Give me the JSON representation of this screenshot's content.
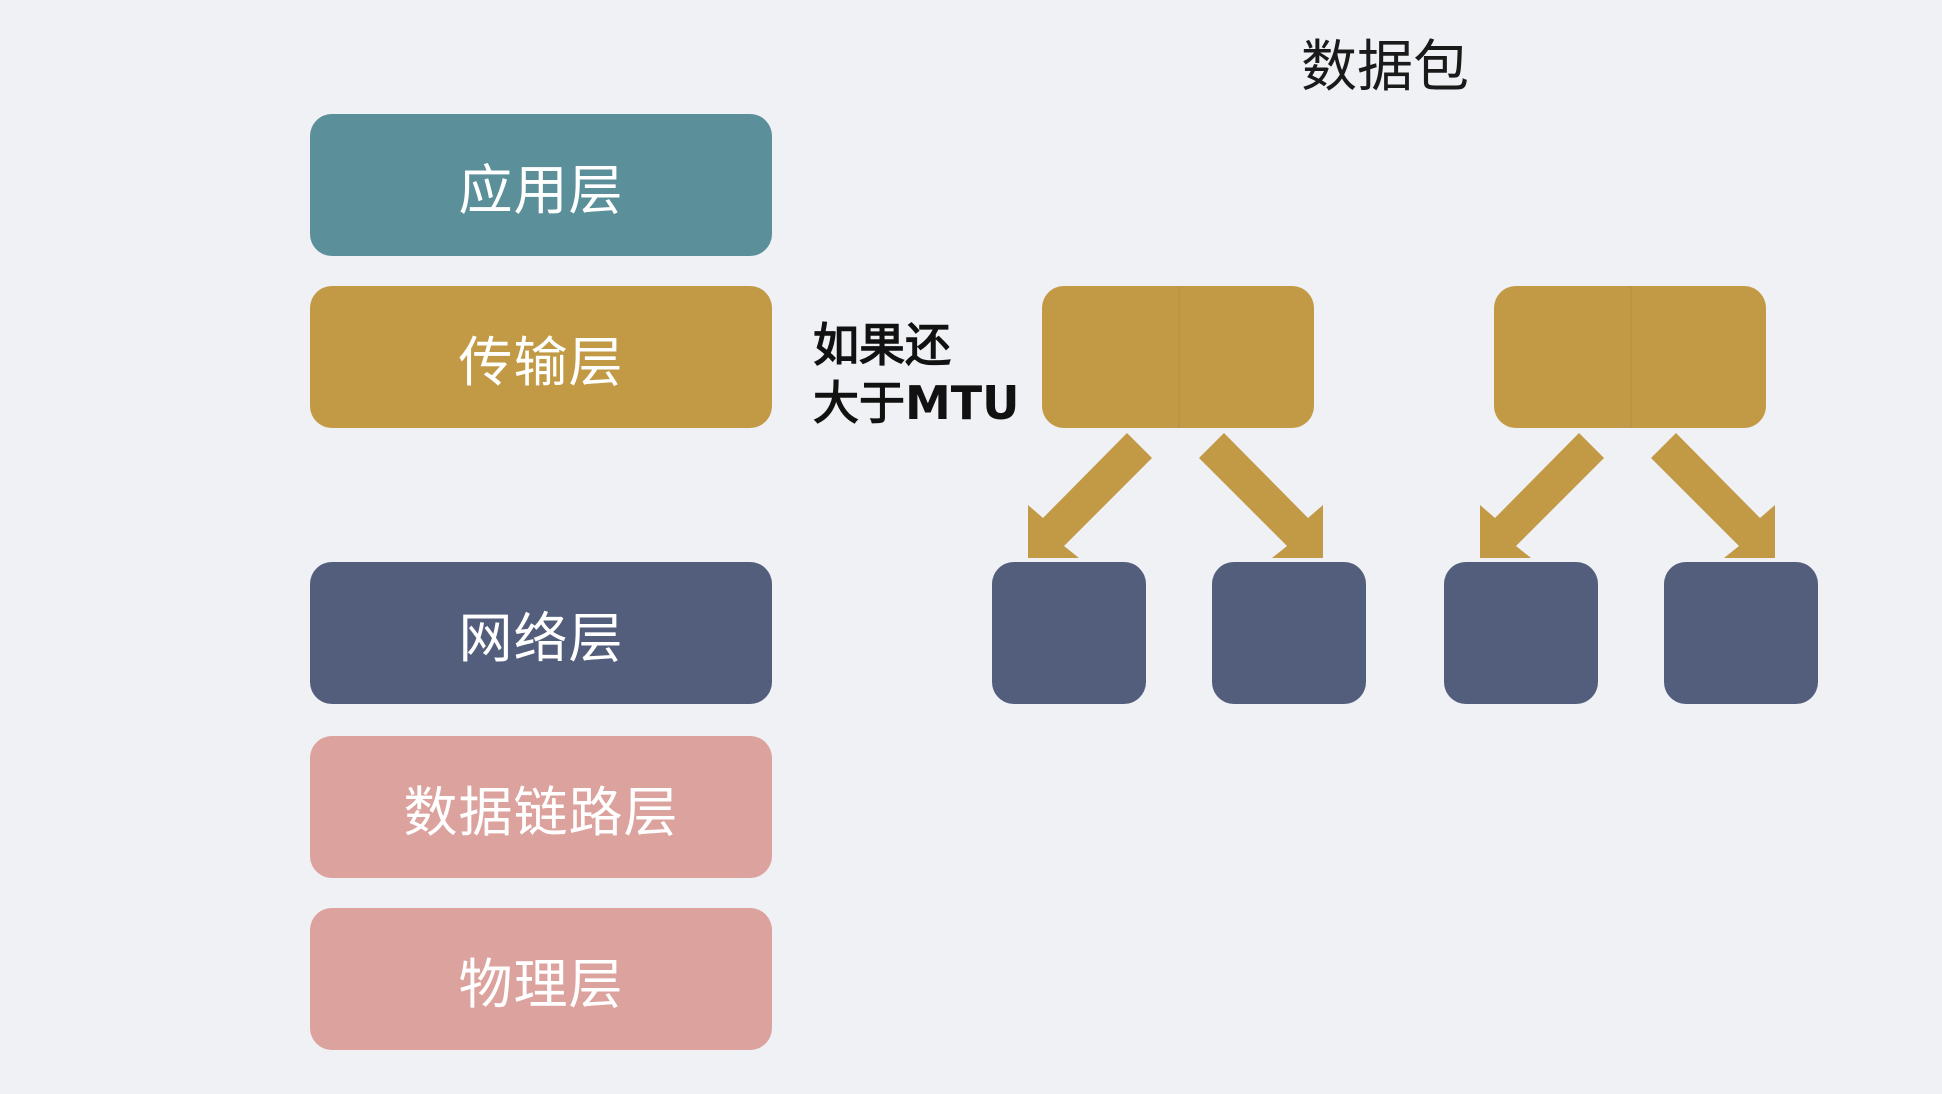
{
  "title": "数据包",
  "note": {
    "line1": "如果还",
    "line2": "大于MTU"
  },
  "layers": [
    {
      "label": "应用层",
      "color": "#5b8f99"
    },
    {
      "label": "传输层",
      "color": "#c29a46"
    },
    {
      "label": "网络层",
      "color": "#535e7d"
    },
    {
      "label": "数据链路层",
      "color": "#dca29e"
    },
    {
      "label": "物理层",
      "color": "#dca29e"
    }
  ],
  "colors": {
    "packet": "#c29a46",
    "fragment": "#535e7d",
    "arrow": "#c29a46"
  }
}
